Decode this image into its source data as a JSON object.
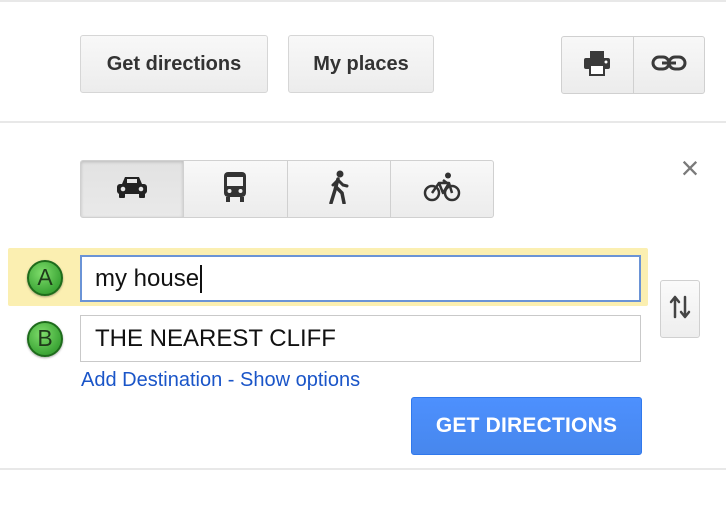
{
  "toolbar": {
    "get_directions_label": "Get directions",
    "my_places_label": "My places",
    "print_icon": "print-icon",
    "link_icon": "link-icon"
  },
  "travel_modes": [
    {
      "name": "car",
      "icon": "car-icon",
      "active": true
    },
    {
      "name": "transit",
      "icon": "bus-icon",
      "active": false
    },
    {
      "name": "walking",
      "icon": "walking-icon",
      "active": false
    },
    {
      "name": "bicycling",
      "icon": "bicycle-icon",
      "active": false
    }
  ],
  "close_symbol": "×",
  "route": {
    "start": {
      "marker": "A",
      "value": "my house"
    },
    "end": {
      "marker": "B",
      "value": "THE NEAREST CLIFF"
    }
  },
  "links": {
    "add_destination": "Add Destination",
    "separator": " - ",
    "show_options": "Show options"
  },
  "submit_label": "GET DIRECTIONS",
  "colors": {
    "accent_blue": "#4d90fe",
    "link_blue": "#1a55c8",
    "marker_green": "#3da637",
    "highlight_yellow": "#fbefb1"
  }
}
